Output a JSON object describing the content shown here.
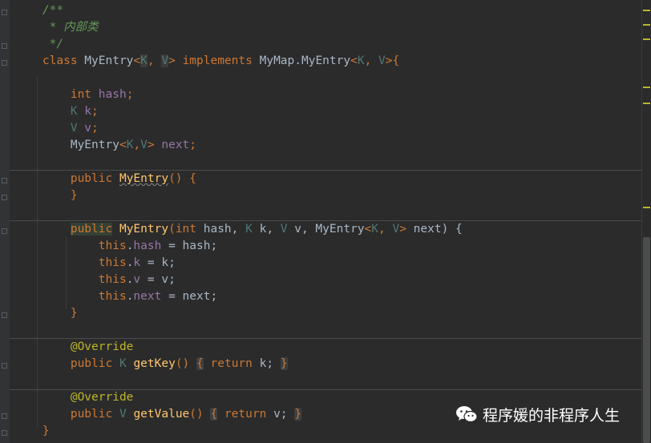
{
  "editor": {
    "lines": [
      {
        "id": "l1",
        "spans": [
          {
            "t": "    /**",
            "c": "cmt"
          }
        ]
      },
      {
        "id": "l2",
        "spans": [
          {
            "t": "     * 内部类",
            "c": "cmt"
          }
        ]
      },
      {
        "id": "l3",
        "spans": [
          {
            "t": "     */",
            "c": "cmt"
          }
        ]
      },
      {
        "id": "l4",
        "spans": [
          {
            "t": "    ",
            "c": ""
          },
          {
            "t": "class",
            "c": "kw"
          },
          {
            "t": " MyEntry",
            "c": "type"
          },
          {
            "t": "<",
            "c": "kw"
          },
          {
            "t": "K",
            "c": "tp hl2"
          },
          {
            "t": ", ",
            "c": "kw"
          },
          {
            "t": "V",
            "c": "tp hl2"
          },
          {
            "t": "> ",
            "c": "kw"
          },
          {
            "t": "implements",
            "c": "kw"
          },
          {
            "t": " MyMap.MyEntry",
            "c": "type"
          },
          {
            "t": "<",
            "c": "kw"
          },
          {
            "t": "K",
            "c": "tp"
          },
          {
            "t": ", ",
            "c": "kw"
          },
          {
            "t": "V",
            "c": "tp"
          },
          {
            "t": ">{",
            "c": "kw"
          }
        ]
      },
      {
        "id": "l5",
        "spans": [
          {
            "t": "",
            "c": ""
          }
        ]
      },
      {
        "id": "l6",
        "spans": [
          {
            "t": "        ",
            "c": ""
          },
          {
            "t": "int",
            "c": "kw"
          },
          {
            "t": " hash",
            "c": "field"
          },
          {
            "t": ";",
            "c": "kw"
          }
        ]
      },
      {
        "id": "l7",
        "spans": [
          {
            "t": "        ",
            "c": ""
          },
          {
            "t": "K",
            "c": "tp"
          },
          {
            "t": " k",
            "c": "field"
          },
          {
            "t": ";",
            "c": "kw"
          }
        ]
      },
      {
        "id": "l8",
        "spans": [
          {
            "t": "        ",
            "c": ""
          },
          {
            "t": "V",
            "c": "tp"
          },
          {
            "t": " v",
            "c": "field"
          },
          {
            "t": ";",
            "c": "kw"
          }
        ]
      },
      {
        "id": "l9",
        "spans": [
          {
            "t": "        MyEntry",
            "c": "type"
          },
          {
            "t": "<",
            "c": "kw"
          },
          {
            "t": "K",
            "c": "tp"
          },
          {
            "t": ",",
            "c": "kw"
          },
          {
            "t": "V",
            "c": "tp"
          },
          {
            "t": ">",
            "c": "kw"
          },
          {
            "t": " next",
            "c": "field"
          },
          {
            "t": ";",
            "c": "kw"
          }
        ]
      },
      {
        "id": "l10",
        "spans": [
          {
            "t": "",
            "c": ""
          }
        ]
      },
      {
        "id": "l11",
        "spans": [
          {
            "t": "        ",
            "c": ""
          },
          {
            "t": "public",
            "c": "kw"
          },
          {
            "t": " ",
            "c": ""
          },
          {
            "t": "MyEntry",
            "c": "fn squig"
          },
          {
            "t": "() {",
            "c": "kw"
          }
        ]
      },
      {
        "id": "l12",
        "spans": [
          {
            "t": "        }",
            "c": "kw"
          }
        ]
      },
      {
        "id": "l13",
        "spans": [
          {
            "t": "",
            "c": ""
          }
        ]
      },
      {
        "id": "l14",
        "spans": [
          {
            "t": "        ",
            "c": ""
          },
          {
            "t": "public",
            "c": "kw hl"
          },
          {
            "t": " ",
            "c": ""
          },
          {
            "t": "MyEntry",
            "c": "fn"
          },
          {
            "t": "(",
            "c": "kw"
          },
          {
            "t": "int",
            "c": "kw"
          },
          {
            "t": " hash, ",
            "c": "type"
          },
          {
            "t": "K",
            "c": "tp"
          },
          {
            "t": " k, ",
            "c": "type"
          },
          {
            "t": "V",
            "c": "tp"
          },
          {
            "t": " v, MyEntry",
            "c": "type"
          },
          {
            "t": "<",
            "c": "kw"
          },
          {
            "t": "K",
            "c": "tp"
          },
          {
            "t": ", ",
            "c": "kw"
          },
          {
            "t": "V",
            "c": "tp"
          },
          {
            "t": ">",
            "c": "kw"
          },
          {
            "t": " next) {",
            "c": "type"
          }
        ]
      },
      {
        "id": "l15",
        "spans": [
          {
            "t": "            ",
            "c": ""
          },
          {
            "t": "this",
            "c": "kw"
          },
          {
            "t": ".",
            "c": "type"
          },
          {
            "t": "hash",
            "c": "field"
          },
          {
            "t": " = hash;",
            "c": "type"
          }
        ]
      },
      {
        "id": "l16",
        "spans": [
          {
            "t": "            ",
            "c": ""
          },
          {
            "t": "this",
            "c": "kw"
          },
          {
            "t": ".",
            "c": "type"
          },
          {
            "t": "k",
            "c": "field"
          },
          {
            "t": " = k;",
            "c": "type"
          }
        ]
      },
      {
        "id": "l17",
        "spans": [
          {
            "t": "            ",
            "c": ""
          },
          {
            "t": "this",
            "c": "kw"
          },
          {
            "t": ".",
            "c": "type"
          },
          {
            "t": "v",
            "c": "field"
          },
          {
            "t": " = v;",
            "c": "type"
          }
        ]
      },
      {
        "id": "l18",
        "spans": [
          {
            "t": "            ",
            "c": ""
          },
          {
            "t": "this",
            "c": "kw"
          },
          {
            "t": ".",
            "c": "type"
          },
          {
            "t": "next",
            "c": "field"
          },
          {
            "t": " = next;",
            "c": "type"
          }
        ]
      },
      {
        "id": "l19",
        "spans": [
          {
            "t": "        }",
            "c": "kw"
          }
        ]
      },
      {
        "id": "l20",
        "spans": [
          {
            "t": "",
            "c": ""
          }
        ]
      },
      {
        "id": "l21",
        "spans": [
          {
            "t": "        ",
            "c": ""
          },
          {
            "t": "@Override",
            "c": "anno"
          }
        ]
      },
      {
        "id": "l22",
        "spans": [
          {
            "t": "        ",
            "c": ""
          },
          {
            "t": "public",
            "c": "kw"
          },
          {
            "t": " ",
            "c": ""
          },
          {
            "t": "K",
            "c": "tp"
          },
          {
            "t": " ",
            "c": ""
          },
          {
            "t": "getKey",
            "c": "fn"
          },
          {
            "t": "() ",
            "c": "kw"
          },
          {
            "t": "{",
            "c": "kw brace-box"
          },
          {
            "t": " ",
            "c": ""
          },
          {
            "t": "return",
            "c": "kw"
          },
          {
            "t": " k;",
            "c": "type"
          },
          {
            "t": " ",
            "c": ""
          },
          {
            "t": "}",
            "c": "kw brace-box"
          }
        ]
      },
      {
        "id": "l23",
        "spans": [
          {
            "t": "",
            "c": ""
          }
        ]
      },
      {
        "id": "l24",
        "spans": [
          {
            "t": "        ",
            "c": ""
          },
          {
            "t": "@Override",
            "c": "anno"
          }
        ]
      },
      {
        "id": "l25",
        "spans": [
          {
            "t": "        ",
            "c": ""
          },
          {
            "t": "public",
            "c": "kw"
          },
          {
            "t": " ",
            "c": ""
          },
          {
            "t": "V",
            "c": "tp"
          },
          {
            "t": " ",
            "c": ""
          },
          {
            "t": "getValue",
            "c": "fn"
          },
          {
            "t": "() ",
            "c": "kw"
          },
          {
            "t": "{",
            "c": "kw brace-box"
          },
          {
            "t": " ",
            "c": ""
          },
          {
            "t": "return",
            "c": "kw"
          },
          {
            "t": " v;",
            "c": "type"
          },
          {
            "t": " ",
            "c": ""
          },
          {
            "t": "}",
            "c": "kw brace-box"
          }
        ]
      },
      {
        "id": "l26",
        "spans": [
          {
            "t": "    }",
            "c": "kw"
          }
        ]
      }
    ]
  },
  "watermark": {
    "text": "程序媛的非程序人生",
    "icon": "wechat-icon"
  },
  "colors": {
    "background": "#2b2b2b",
    "keyword": "#cc7832",
    "function": "#ffc66d",
    "field": "#9876aa",
    "type_param": "#507874",
    "annotation": "#bbb529",
    "comment": "#629755"
  }
}
